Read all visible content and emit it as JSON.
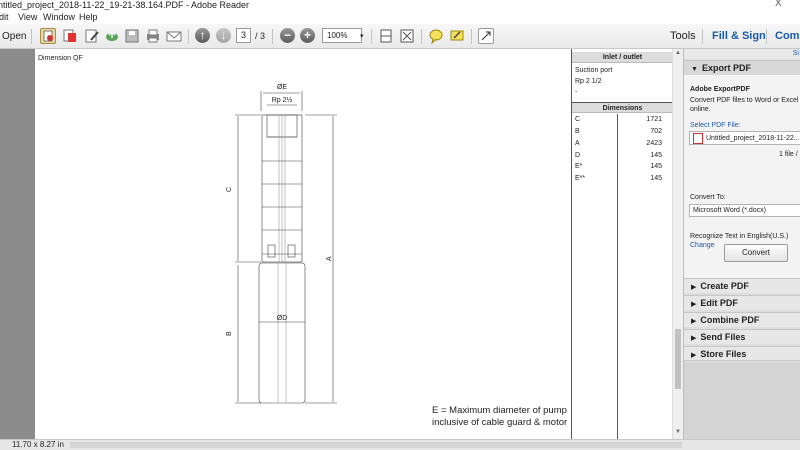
{
  "window": {
    "title": "ntitled_project_2018-11-22_19-21-38.164.PDF - Adobe Reader",
    "close_glyph": "X"
  },
  "menu": [
    "dit",
    "View",
    "Window",
    "Help"
  ],
  "toolbar": {
    "open_label": "Open",
    "page_current": "3",
    "page_total": "/ 3",
    "zoom_value": "100%",
    "zoom_out_glyph": "−",
    "zoom_in_glyph": "+",
    "tools_label": "Tools",
    "fill_sign_label": "Fill & Sign",
    "comment_label": "Comm"
  },
  "document": {
    "caption": "Dimension QF",
    "drawing": {
      "label_oe": "ØE",
      "label_rp": "Rp 2½",
      "label_od": "ØD",
      "label_c": "C",
      "label_a": "A",
      "label_b": "B"
    },
    "inlet_header": "Inlet / outlet",
    "inlet_lines": [
      "Suction port",
      "Rp 2 1/2",
      "-"
    ],
    "dimensions_header": "Dimensions",
    "dimensions": [
      {
        "label": "C",
        "value": "1721"
      },
      {
        "label": "B",
        "value": "702"
      },
      {
        "label": "A",
        "value": "2423"
      },
      {
        "label": "D",
        "value": "145"
      },
      {
        "label": "E*",
        "value": "145"
      },
      {
        "label": "E**",
        "value": "145"
      }
    ],
    "note_line1": "E = Maximum diameter of pump",
    "note_line2": "inclusive of cable guard & motor"
  },
  "status": {
    "page_size": "11.70 x 8.27 in"
  },
  "right_pane": {
    "sign_tab": "Si",
    "export_pdf": {
      "header": "Export PDF",
      "title": "Adobe ExportPDF",
      "desc_line1": "Convert PDF files to Word or Excel",
      "desc_line2": "online.",
      "select_label": "Select PDF File:",
      "file_name": "Untitled_project_2018-11-22...",
      "file_count": "1 file /",
      "convert_to_label": "Convert To:",
      "convert_to_value": "Microsoft Word (*.docx)",
      "recognize_text": "Recognize Text in English(U.S.)",
      "change_link": "Change",
      "convert_button": "Convert"
    },
    "sections": [
      "Create PDF",
      "Edit PDF",
      "Combine PDF",
      "Send Files",
      "Store Files"
    ]
  },
  "colors": {
    "accent": "#1a5aa8",
    "doc_background": "#8b8b8b"
  }
}
